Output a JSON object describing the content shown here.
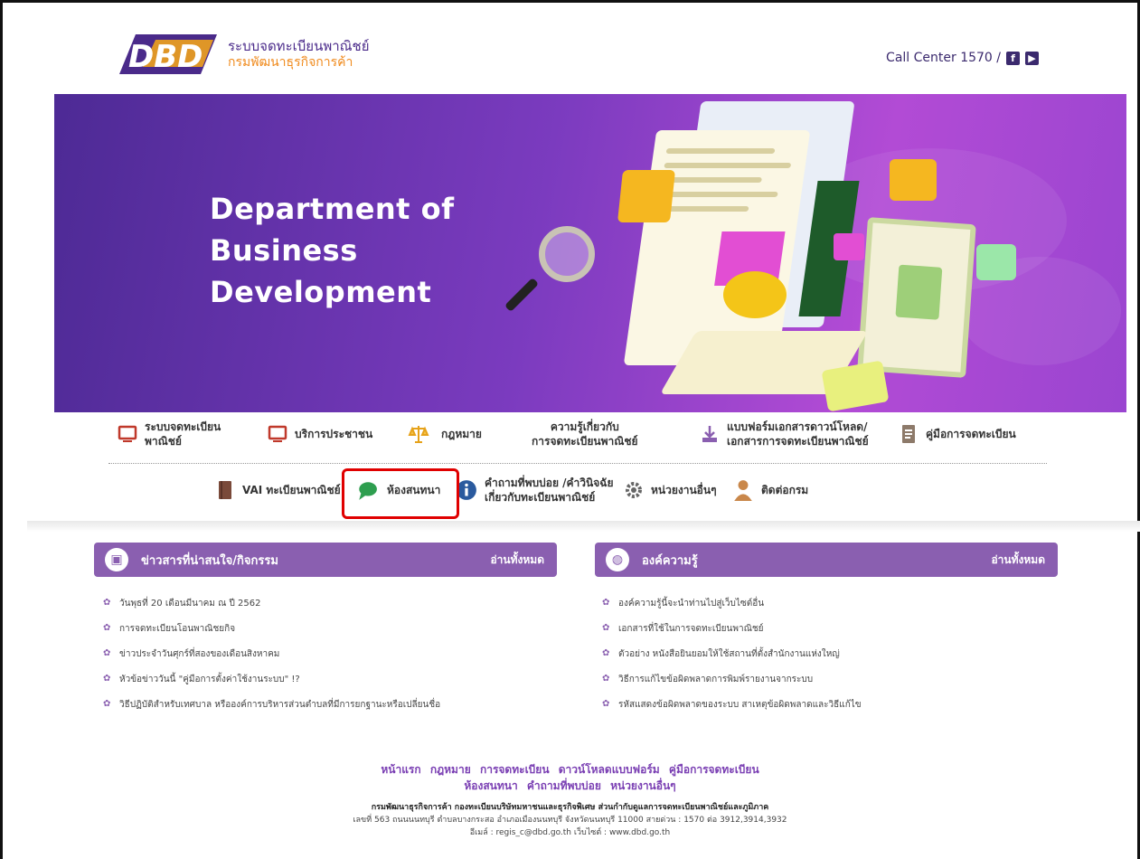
{
  "header": {
    "logo_text": "DBD",
    "brand_line1": "ระบบจดทะเบียนพาณิชย์",
    "brand_line2": "กรมพัฒนาธุรกิจการค้า",
    "call_center": "Call Center 1570 /"
  },
  "banner": {
    "title_lines": [
      "Department of",
      "Business",
      "Development"
    ]
  },
  "nav": {
    "row1": [
      {
        "icon": "monitor-icon",
        "label1": "ระบบจดทะเบียน",
        "label2": "พาณิชย์"
      },
      {
        "icon": "monitor-icon",
        "label1": "บริการประชาชน",
        "label2": ""
      },
      {
        "icon": "scale-icon",
        "label1": "กฎหมาย",
        "label2": ""
      },
      {
        "icon": "none",
        "label1": "ความรู้เกี่ยวกับ",
        "label2": "การจดทะเบียนพาณิชย์"
      },
      {
        "icon": "download-icon",
        "label1": "แบบฟอร์มเอกสารดาวน์โหลด/",
        "label2": "เอกสารการจดทะเบียนพาณิชย์"
      },
      {
        "icon": "document-icon",
        "label1": "คู่มือการจดทะเบียน",
        "label2": ""
      }
    ],
    "row2": [
      {
        "icon": "book-icon",
        "label1": "VAI ทะเบียนพาณิชย์",
        "label2": ""
      },
      {
        "icon": "chat-icon",
        "label1": "ห้องสนทนา",
        "label2": ""
      },
      {
        "icon": "info-icon",
        "label1": "คำถามที่พบบ่อย /คำวินิจฉัย",
        "label2": "เกี่ยวกับทะเบียนพาณิชย์"
      },
      {
        "icon": "gear-icon",
        "label1": "หน่วยงานอื่นๆ",
        "label2": ""
      },
      {
        "icon": "person-icon",
        "label1": "ติดต่อกรม",
        "label2": ""
      }
    ]
  },
  "news": {
    "title": "ข่าวสารที่น่าสนใจ/กิจกรรม",
    "read_all": "อ่านทั้งหมด",
    "items": [
      "วันพุธที่ 20 เดือนมีนาคม ณ ปี 2562",
      "การจดทะเบียนโอนพาณิชยกิจ",
      "ข่าวประจำวันศุกร์ที่สองของเดือนสิงหาคม",
      "หัวข้อข่าววันนี้ \"คู่มือการตั้งค่าใช้งานระบบ\" !?",
      "วิธีปฏิบัติสำหรับเทศบาล หรือองค์การบริหารส่วนตำบลที่มีการยกฐานะหรือเปลี่ยนชื่อ"
    ]
  },
  "knowledge": {
    "title": "องค์ความรู้",
    "read_all": "อ่านทั้งหมด",
    "items": [
      "องค์ความรู้นี้จะนำท่านไปสู่เว็บไซต์อื่น",
      "เอกสารที่ใช้ในการจดทะเบียนพาณิชย์",
      "ตัวอย่าง หนังสือยินยอมให้ใช้สถานที่ตั้งสำนักงานแห่งใหญ่",
      "วิธีการแก้ไขข้อผิดพลาดการพิมพ์รายงานจากระบบ",
      "รหัสแสดงข้อผิดพลาดของระบบ สาเหตุข้อผิดพลาดและวิธีแก้ไข"
    ]
  },
  "footer": {
    "links_row1": [
      "หน้าแรก",
      "กฎหมาย",
      "การจดทะเบียน",
      "ดาวน์โหลดแบบฟอร์ม",
      "คู่มือการจดทะเบียน"
    ],
    "links_row2": [
      "ห้องสนทนา",
      "คำถามที่พบบ่อย",
      "หน่วยงานอื่นๆ"
    ],
    "org": "กรมพัฒนาธุรกิจการค้า กองทะเบียนบริษัทมหาชนและธุรกิจพิเศษ ส่วนกำกับดูแลการจดทะเบียนพาณิชย์และภูมิภาค",
    "address": "เลขที่ 563 ถนนนนทบุรี ตำบลบางกระสอ อำเภอเมืองนนทบุรี จังหวัดนนทบุรี 11000 สายด่วน : 1570 ต่อ 3912,3914,3932",
    "contact": "อีเมล์ : regis_c@dbd.go.th เว็บไซต์ : www.dbd.go.th"
  },
  "colors": {
    "brand_purple": "#4a2a8a",
    "brand_orange": "#f08a1c",
    "panel_purple": "#8a5fb0",
    "highlight_red": "#e00000"
  }
}
